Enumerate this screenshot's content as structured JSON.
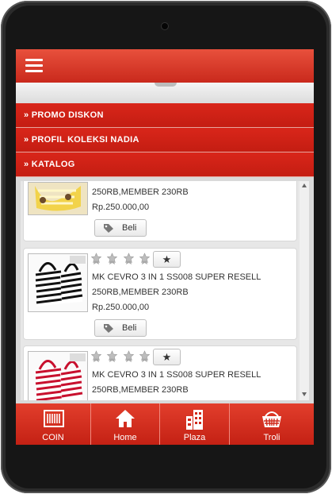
{
  "topbar": {
    "menu_icon": "hamburger-menu-icon"
  },
  "nav": {
    "items": [
      {
        "label": "» PROMO DISKON"
      },
      {
        "label": "» PROFIL KOLEKSI NADIA"
      },
      {
        "label": "» KATALOG"
      }
    ]
  },
  "products": [
    {
      "name": "",
      "price_text": "250RB,MEMBER 230RB",
      "price": "Rp.250.000,00",
      "buy_label": "Beli",
      "image_colors": {
        "bg": "#f4e7b0",
        "stripe": "#e9c23a"
      }
    },
    {
      "name": "MK CEVRO 3 IN 1 SS008 SUPER RESELL",
      "price_text": "250RB,MEMBER 230RB",
      "price": "Rp.250.000,00",
      "buy_label": "Beli",
      "star_button": "★",
      "image_colors": {
        "bg": "#ffffff",
        "stripe": "#111111"
      }
    },
    {
      "name": "MK CEVRO 3 IN 1 SS008 SUPER RESELL",
      "price_text": "250RB,MEMBER 230RB",
      "price": "",
      "buy_label": "",
      "star_button": "★",
      "image_colors": {
        "bg": "#ffffff",
        "stripe": "#c8102e"
      }
    }
  ],
  "bottom_nav": [
    {
      "label": "COIN",
      "icon": "barcode-icon"
    },
    {
      "label": "Home",
      "icon": "home-icon"
    },
    {
      "label": "Plaza",
      "icon": "building-icon"
    },
    {
      "label": "Troli",
      "icon": "basket-icon"
    }
  ],
  "colors": {
    "brand_red": "#d2291c",
    "nav_red": "#c41d12"
  }
}
